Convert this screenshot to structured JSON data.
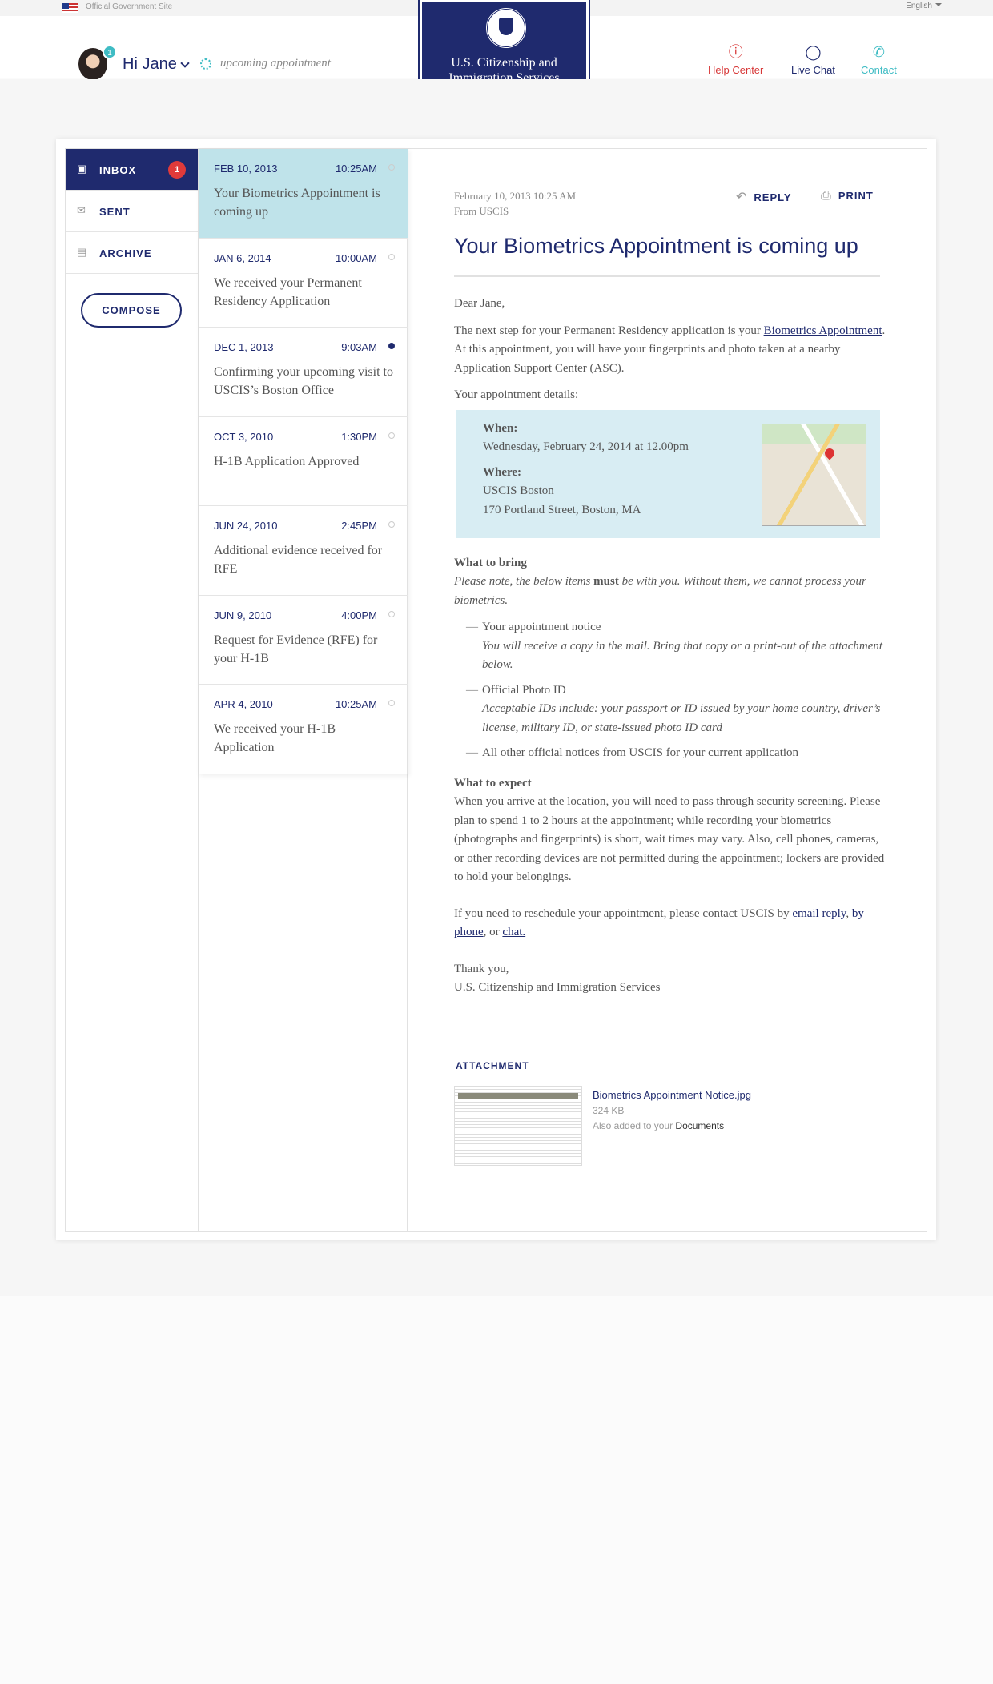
{
  "gov_bar": {
    "text": "Official Government Site",
    "language": "English"
  },
  "user": {
    "greeting": "Hi Jane",
    "badge": "1",
    "status": "upcoming appointment"
  },
  "agency": {
    "line1": "U.S. Citizenship and",
    "line2": "Immigration Services"
  },
  "header_links": {
    "help": "Help Center",
    "chat": "Live Chat",
    "contact": "Contact"
  },
  "sidebar": {
    "inbox": "INBOX",
    "inbox_count": "1",
    "sent": "SENT",
    "archive": "ARCHIVE",
    "compose": "COMPOSE"
  },
  "messages": [
    {
      "date": "FEB 10, 2013",
      "time": "10:25AM",
      "subject": "Your Biometrics Appointment is coming up",
      "unread": false,
      "selected": true
    },
    {
      "date": "JAN 6, 2014",
      "time": "10:00AM",
      "subject": "We received your Permanent Residency Application",
      "unread": false,
      "selected": false
    },
    {
      "date": "DEC 1, 2013",
      "time": "9:03AM",
      "subject": "Confirming your upcoming visit to USCIS’s Boston Office",
      "unread": true,
      "selected": false
    },
    {
      "date": "OCT 3, 2010",
      "time": "1:30PM",
      "subject": "H-1B Application Approved",
      "unread": false,
      "selected": false
    },
    {
      "date": "JUN 24, 2010",
      "time": "2:45PM",
      "subject": "Additional evidence received for RFE",
      "unread": false,
      "selected": false
    },
    {
      "date": "JUN 9, 2010",
      "time": "4:00PM",
      "subject": "Request for Evidence (RFE) for your H-1B",
      "unread": false,
      "selected": false
    },
    {
      "date": "APR 4, 2010",
      "time": "10:25AM",
      "subject": "We received your H-1B Application",
      "unread": false,
      "selected": false
    }
  ],
  "email": {
    "datetime": "February 10, 2013 10:25 AM",
    "from": "From USCIS",
    "reply": "REPLY",
    "print": "PRINT",
    "title": "Your Biometrics Appointment is coming up",
    "greeting": "Dear Jane,",
    "p1_before": "The next step for your Permanent Residency application is your ",
    "p1_link": "Biometrics Appointment",
    "p1_after": ". At this appointment, you will have your fingerprints and photo taken at a nearby Application Support Center (ASC).",
    "details_label": "Your appointment details:",
    "when_label": "When:",
    "when_value": "Wednesday, February 24, 2014 at 12.00pm",
    "where_label": "Where:",
    "where_name": "USCIS Boston",
    "where_address": "170 Portland Street, Boston, MA",
    "bring_heading": "What to bring",
    "bring_note_before": "Please note, the below items ",
    "bring_note_must": "must",
    "bring_note_after": " be with you. Without them, we cannot process your biometrics.",
    "bring_items": [
      {
        "title": "Your appointment notice",
        "note": "You will receive a copy in the mail. Bring that copy or a print-out of the attachment below."
      },
      {
        "title": "Official Photo ID",
        "note": "Acceptable IDs include: your passport or ID issued by your home country, driver’s license, military ID, or state-issued photo ID card"
      },
      {
        "title": "All other official notices from USCIS for your current application",
        "note": ""
      }
    ],
    "expect_heading": "What to expect",
    "expect_text": "When you arrive at the location, you will need to pass through security screening. Please plan to spend 1 to 2 hours at the appointment; while recording your biometrics (photographs and fingerprints) is short, wait times may vary. Also, cell phones, cameras, or other recording devices are not permitted during the appointment; lockers are provided to hold your belongings.",
    "reschedule_before": "If you need to reschedule your appointment, please contact USCIS by ",
    "link_email": "email reply",
    "sep1": ", ",
    "link_phone": "by phone",
    "sep2": ", or ",
    "link_chat": "chat.",
    "thanks": "Thank you,",
    "signature": "U.S. Citizenship and Immigration Services"
  },
  "attachment": {
    "heading": "ATTACHMENT",
    "filename": "Biometrics Appointment Notice.jpg",
    "size": "324 KB",
    "note_before": "Also added to your ",
    "note_link": "Documents"
  },
  "icons": [
    "flag-icon",
    "sun-icon",
    "help-icon",
    "chat-icon",
    "phone-icon",
    "inbox-icon",
    "sent-icon",
    "archive-icon",
    "reply-icon",
    "print-icon",
    "map-image"
  ],
  "colors": {
    "navy": "#1f2a6e",
    "teal": "#3fbcc4",
    "red": "#e03a3a",
    "selected_bg": "#bfe3ea",
    "appt_bg": "#d8edf3"
  }
}
